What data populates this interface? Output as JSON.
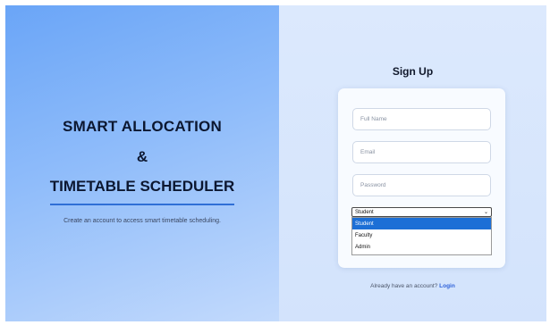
{
  "brand": {
    "line1": "SMART ALLOCATION",
    "amp": "&",
    "line3": "TIMETABLE SCHEDULER",
    "tagline": "Create an account to access smart timetable scheduling."
  },
  "form": {
    "title": "Sign Up",
    "full_name_placeholder": "Full Name",
    "email_placeholder": "Email",
    "password_placeholder": "Password",
    "role_selected": "Student",
    "role_options": [
      "Student",
      "Faculty",
      "Admin"
    ],
    "highlighted_option": "Student",
    "login_prompt": "Already have an account?",
    "login_link": "Login"
  },
  "colors": {
    "accent": "#2f6fd6",
    "link": "#2f62d9",
    "option_highlight": "#1c6fd6"
  }
}
